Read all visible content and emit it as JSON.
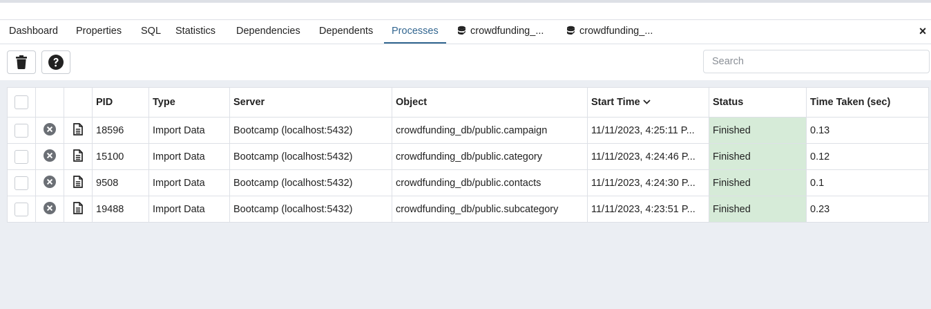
{
  "tabs": [
    {
      "label": "Dashboard"
    },
    {
      "label": "Properties"
    },
    {
      "label": "SQL"
    },
    {
      "label": "Statistics"
    },
    {
      "label": "Dependencies"
    },
    {
      "label": "Dependents"
    },
    {
      "label": "Processes",
      "active": true
    },
    {
      "label": "crowdfunding_...",
      "icon": "database-icon"
    },
    {
      "label": "crowdfunding_...",
      "icon": "database-icon"
    }
  ],
  "close_label": "×",
  "toolbar": {
    "delete_icon": "trash-icon",
    "help_icon": "help-icon",
    "search_placeholder": "Search"
  },
  "table": {
    "headers": [
      "PID",
      "Type",
      "Server",
      "Object",
      "Start Time",
      "Status",
      "Time Taken (sec)"
    ],
    "sorted_column": "Start Time",
    "rows": [
      {
        "pid": "18596",
        "type": "Import Data",
        "server": "Bootcamp (localhost:5432)",
        "object": "crowdfunding_db/public.campaign",
        "start": "11/11/2023, 4:25:11 P...",
        "status": "Finished",
        "time": "0.13"
      },
      {
        "pid": "15100",
        "type": "Import Data",
        "server": "Bootcamp (localhost:5432)",
        "object": "crowdfunding_db/public.category",
        "start": "11/11/2023, 4:24:46 P...",
        "status": "Finished",
        "time": "0.12"
      },
      {
        "pid": "9508",
        "type": "Import Data",
        "server": "Bootcamp (localhost:5432)",
        "object": "crowdfunding_db/public.contacts",
        "start": "11/11/2023, 4:24:30 P...",
        "status": "Finished",
        "time": "0.1"
      },
      {
        "pid": "19488",
        "type": "Import Data",
        "server": "Bootcamp (localhost:5432)",
        "object": "crowdfunding_db/public.subcategory",
        "start": "11/11/2023, 4:23:51 P...",
        "status": "Finished",
        "time": "0.23"
      }
    ]
  },
  "colors": {
    "accent": "#326690",
    "status_finished_bg": "#d6ebd8",
    "panel_bg": "#ebeef3"
  }
}
